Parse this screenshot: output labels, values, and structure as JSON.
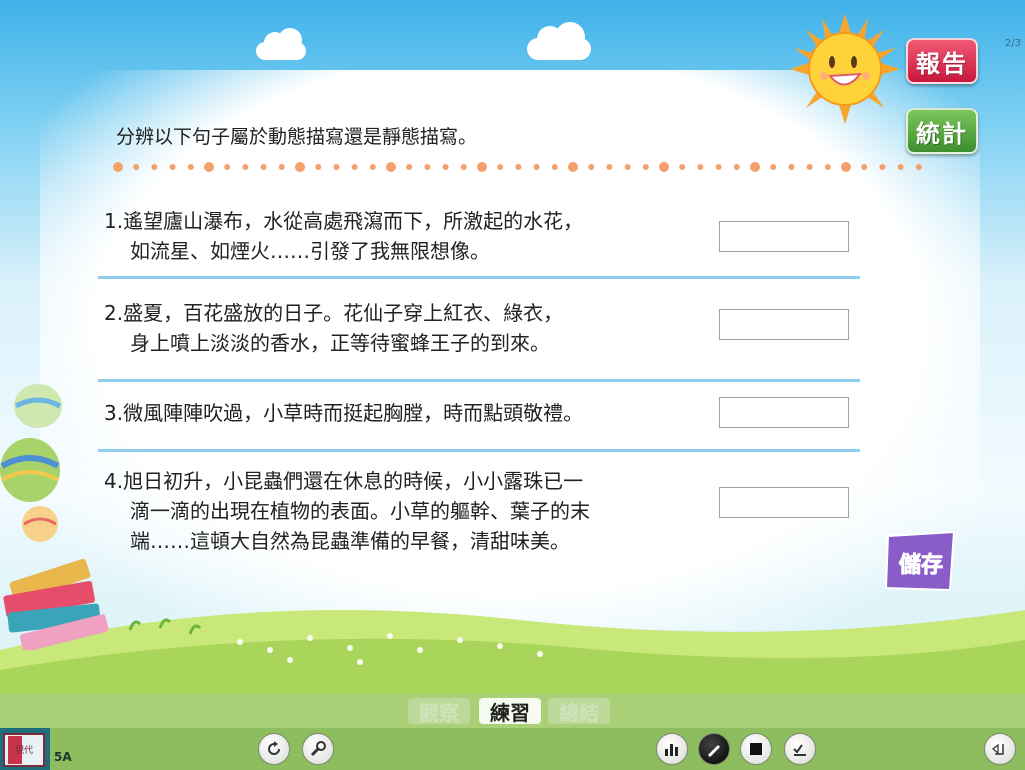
{
  "page_indicator": "2/3",
  "buttons": {
    "report": "報告",
    "stats": "統計",
    "save": "儲存"
  },
  "instruction": "分辨以下句子屬於動態描寫還是靜態描寫。",
  "questions": [
    {
      "line1": "1.遙望廬山瀑布，水從高處飛瀉而下，所激起的水花，",
      "line2": "如流星、如煙火……引發了我無限想像。",
      "line3": "",
      "answer": ""
    },
    {
      "line1": "2.盛夏，百花盛放的日子。花仙子穿上紅衣、綠衣，",
      "line2": "身上噴上淡淡的香水，正等待蜜蜂王子的到來。",
      "line3": "",
      "answer": ""
    },
    {
      "line1": "3.微風陣陣吹過，小草時而挺起胸膛，時而點頭敬禮。",
      "line2": "",
      "line3": "",
      "answer": ""
    },
    {
      "line1": "4.旭日初升，小昆蟲們還在休息的時候，小小露珠已一",
      "line2": "滴一滴的出現在植物的表面。小草的軀幹、葉子的末",
      "line3": "端……這頓大自然為昆蟲準備的早餐，清甜味美。",
      "answer": ""
    }
  ],
  "tabs": {
    "observe": "觀察",
    "practice": "練習",
    "summary": "總結",
    "active": "practice"
  },
  "footer": {
    "book_logo": "現代",
    "grade": "5A"
  },
  "toolbar_icons": [
    "refresh-icon",
    "wrench-icon",
    "bar-chart-icon",
    "pen-icon",
    "fullscreen-icon",
    "checklist-icon",
    "exit-icon"
  ],
  "colors": {
    "report": "#d6244a",
    "stats": "#4fa53c",
    "divider": "#8ecfee",
    "dots": "#f4a06a"
  }
}
